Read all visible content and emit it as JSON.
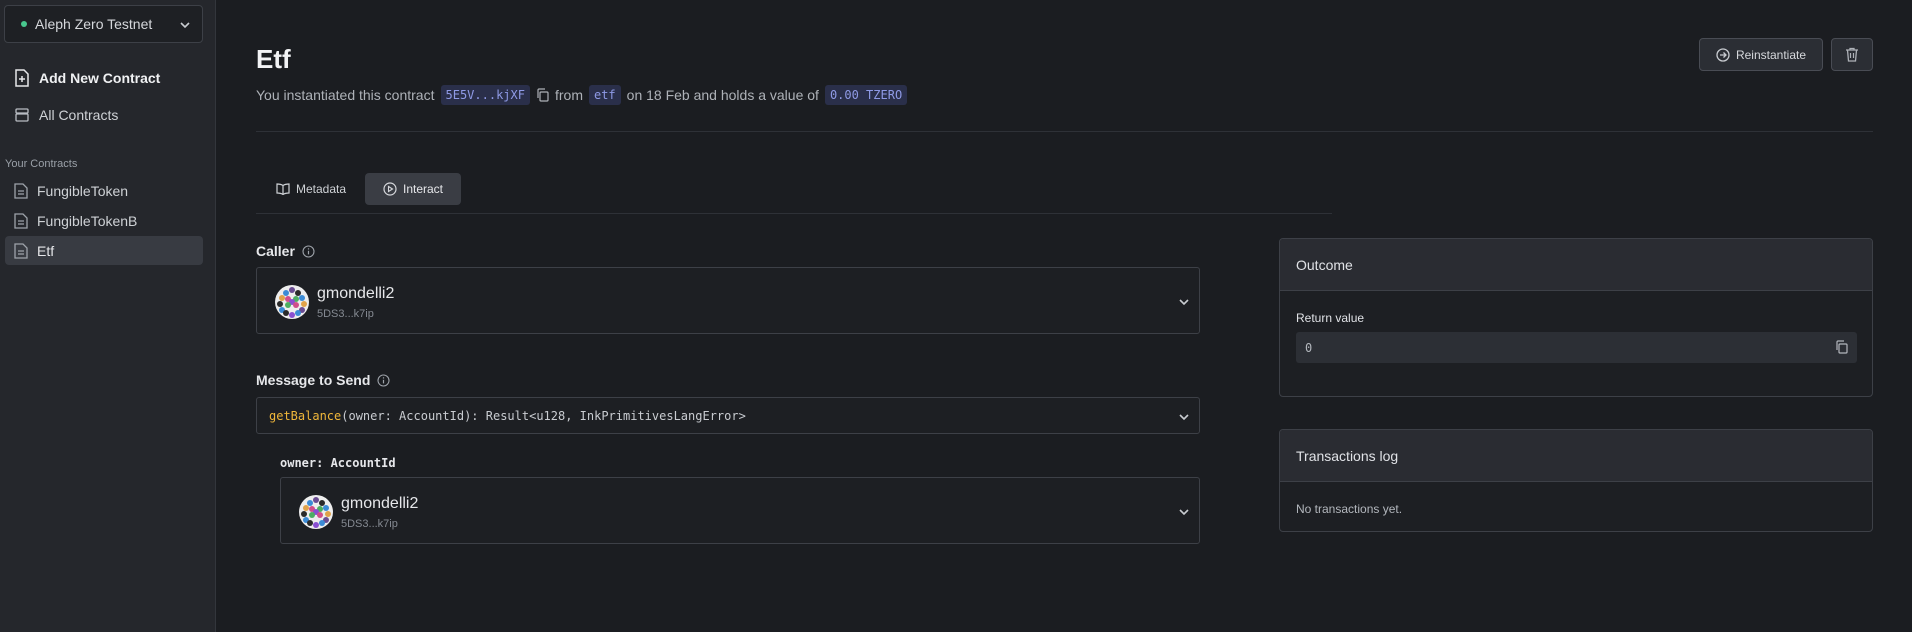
{
  "sidebar": {
    "network": "Aleph Zero Testnet",
    "add_new_contract": "Add New Contract",
    "all_contracts": "All Contracts",
    "your_contracts_heading": "Your Contracts",
    "contracts": [
      {
        "label": "FungibleToken"
      },
      {
        "label": "FungibleTokenB"
      },
      {
        "label": "Etf"
      }
    ]
  },
  "header": {
    "title": "Etf",
    "sub_prefix": "You instantiated this contract",
    "address": "5E5V...kjXF",
    "sub_from": "from",
    "source": "etf",
    "sub_on": "on 18 Feb and holds a value of",
    "value": "0.00 TZERO",
    "reinstantiate": "Reinstantiate"
  },
  "tabs": [
    {
      "label": "Metadata"
    },
    {
      "label": "Interact"
    }
  ],
  "caller": {
    "label": "Caller",
    "name": "gmondelli2",
    "address": "5DS3...k7ip"
  },
  "message": {
    "label": "Message to Send",
    "fn": "getBalance",
    "signature": "(owner: AccountId): Result<u128, InkPrimitivesLangError>",
    "arg_label": "owner: AccountId",
    "arg_name": "gmondelli2",
    "arg_address": "5DS3...k7ip"
  },
  "outcome": {
    "title": "Outcome",
    "return_label": "Return value",
    "return_value": "0"
  },
  "txlog": {
    "title": "Transactions log",
    "empty": "No transactions yet."
  },
  "colors": {
    "accent_tag_bg": "#2a2f4a",
    "accent_tag_text": "#8f9ae6",
    "fn_highlight": "#f0b73a",
    "network_dot": "#48c78e"
  }
}
